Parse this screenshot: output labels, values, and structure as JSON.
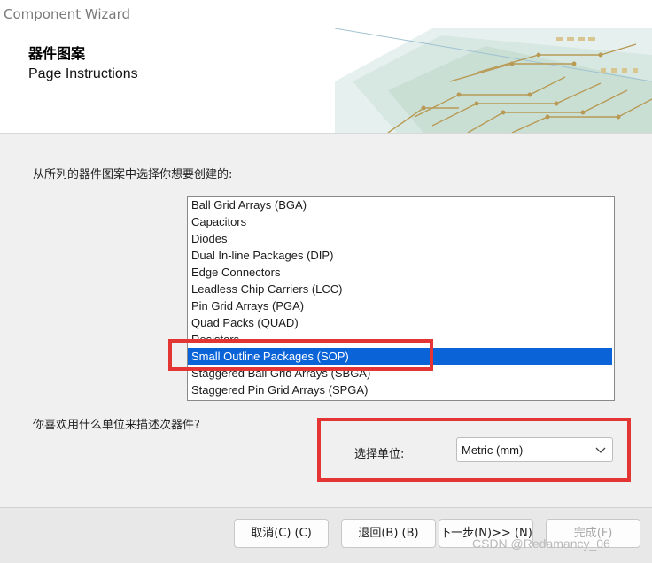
{
  "window": {
    "title": "Component Wizard"
  },
  "header": {
    "title": "器件图案",
    "subtitle": "Page Instructions"
  },
  "patterns": {
    "prompt": "从所列的器件图案中选择你想要创建的:",
    "items": [
      "Ball Grid Arrays (BGA)",
      "Capacitors",
      "Diodes",
      "Dual In-line Packages (DIP)",
      "Edge Connectors",
      "Leadless Chip Carriers (LCC)",
      "Pin Grid Arrays (PGA)",
      "Quad Packs (QUAD)",
      "Resistors",
      "Small Outline Packages (SOP)",
      "Staggered Ball Grid Arrays (SBGA)",
      "Staggered Pin Grid Arrays (SPGA)"
    ],
    "selected": "Small Outline Packages (SOP)"
  },
  "units": {
    "prompt": "你喜欢用什么单位来描述次器件?",
    "label": "选择单位:",
    "value": "Metric (mm)"
  },
  "buttons": {
    "cancel": "取消(C) (C)",
    "back": "退回(B) (B)",
    "next": "下一步(N)>> (N)",
    "finish": "完成(F)"
  },
  "watermark": "CSDN @Redamancy_06",
  "colors": {
    "selection": "#0a64d8",
    "highlight_box": "#e43535"
  }
}
